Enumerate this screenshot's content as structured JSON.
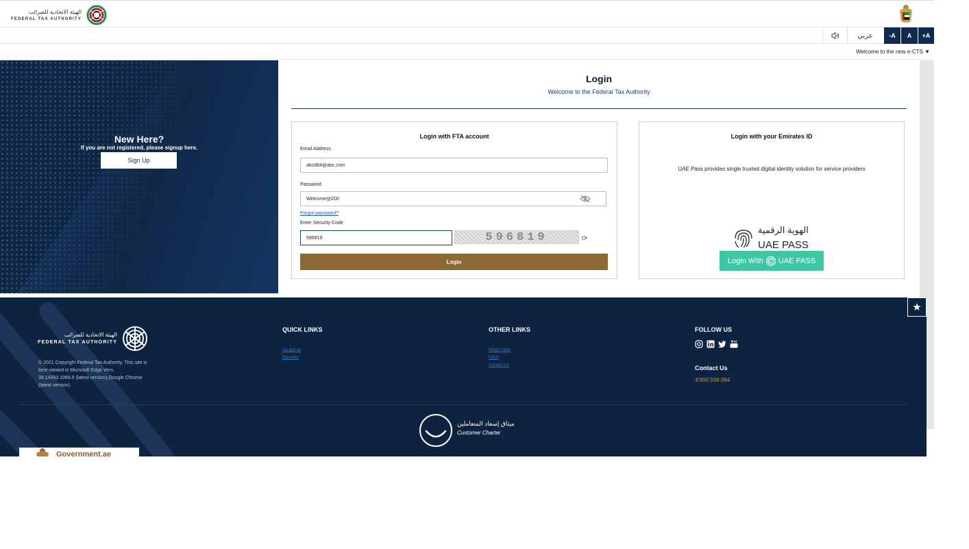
{
  "header": {
    "logo_ar": "الهيئة الاتحادية للضرائب",
    "logo_en": "FEDERAL TAX AUTHORITY"
  },
  "toolbar": {
    "speaker_icon": "speaker-icon",
    "lang_label": "عربي",
    "font_decrease": "-A",
    "font_normal": "A",
    "font_increase": "+A",
    "welcome": "Welcome to the new e-CTS ▼"
  },
  "hero": {
    "title": "New Here?",
    "subtitle": "If you are not registered, please signup here.",
    "signup_label": "Sign Up"
  },
  "login": {
    "title": "Login",
    "subtitle": "Welcome to the Federal Tax Authority",
    "fta_card_title": "Login with FTA account",
    "email_label": "Email Address",
    "email_value": "abcd64@abc.com",
    "password_label": "Password",
    "password_value": "Welcome@200",
    "forgot_label": "Forgot password?",
    "security_label": "Enter Security Code",
    "security_value": "596819",
    "captcha_text": "596819",
    "login_label": "Login"
  },
  "emirates_id": {
    "title": "Login with your Emirates ID",
    "description": "UAE Pass provides single trusted digital identity solution for service providers",
    "logo_ar": "الهوية الرقمية",
    "logo_en": "UAE PASS",
    "button_prefix": "Login With",
    "button_brand": "UAE PASS",
    "brand_color": "#3cc7a2"
  },
  "footer": {
    "logo_ar": "الهيئة الاتحادية للضرائب",
    "logo_en": "FEDERAL TAX AUTHORITY",
    "copyright": "© 2021 Copyright Federal Tax Authority. This site is best viewed in Microsoft Edge Vers. 38.14393.1066.0 (latest version),Google Chrome (latest version).",
    "quick_links_title": "QUICK LINKS",
    "quick_links": [
      "tax.gov.ae",
      "Glossary"
    ],
    "other_links_title": "OTHER LINKS",
    "other_links": [
      "What's New",
      "FAQs",
      "Contact Us"
    ],
    "follow_title": "FOLLOW US",
    "social": [
      "instagram-icon",
      "linkedin-icon",
      "twitter-icon",
      "youtube-icon"
    ],
    "contact_title": "Contact Us",
    "phone": "600 599 994",
    "charter_ar": "ميثاق إسعاد المتعاملين",
    "charter_en": "Customer Charter",
    "gov_label": "Government.ae",
    "background_color": "#0e2340",
    "accent_color": "#8d6a35"
  }
}
